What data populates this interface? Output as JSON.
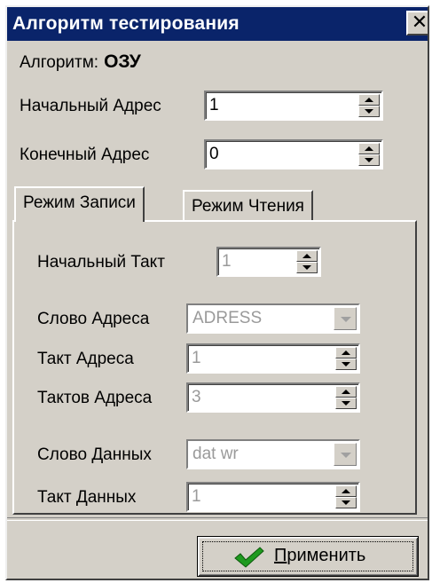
{
  "window": {
    "title": "Алгоритм тестирования",
    "close_glyph": "✕"
  },
  "algorithm": {
    "label": "Алгоритм:",
    "value": "ОЗУ"
  },
  "start_address": {
    "label": "Начальный Адрес",
    "value": "1"
  },
  "end_address": {
    "label": "Конечный Адрес",
    "value": "0"
  },
  "tabs": [
    {
      "label": "Режим Записи",
      "active": true
    },
    {
      "label": "Режим Чтения",
      "active": false
    }
  ],
  "write_mode": {
    "start_tact": {
      "label": "Начальный Такт",
      "value": "1"
    },
    "address_word": {
      "label": "Слово Адреса",
      "value": "ADRESS"
    },
    "address_tact": {
      "label": "Такт Адреса",
      "value": "1"
    },
    "address_tacts": {
      "label": "Тактов Адреса",
      "value": "3"
    },
    "data_word": {
      "label": "Слово Данных",
      "value": "dat wr"
    },
    "data_tact": {
      "label": "Такт Данных",
      "value": "1"
    }
  },
  "apply_button": {
    "label_first": "П",
    "label_rest": "рименить",
    "icon": "check-icon"
  },
  "colors": {
    "titlebar": "#0a246a",
    "face": "#d4d0c8",
    "check": "#1f9a1f"
  }
}
